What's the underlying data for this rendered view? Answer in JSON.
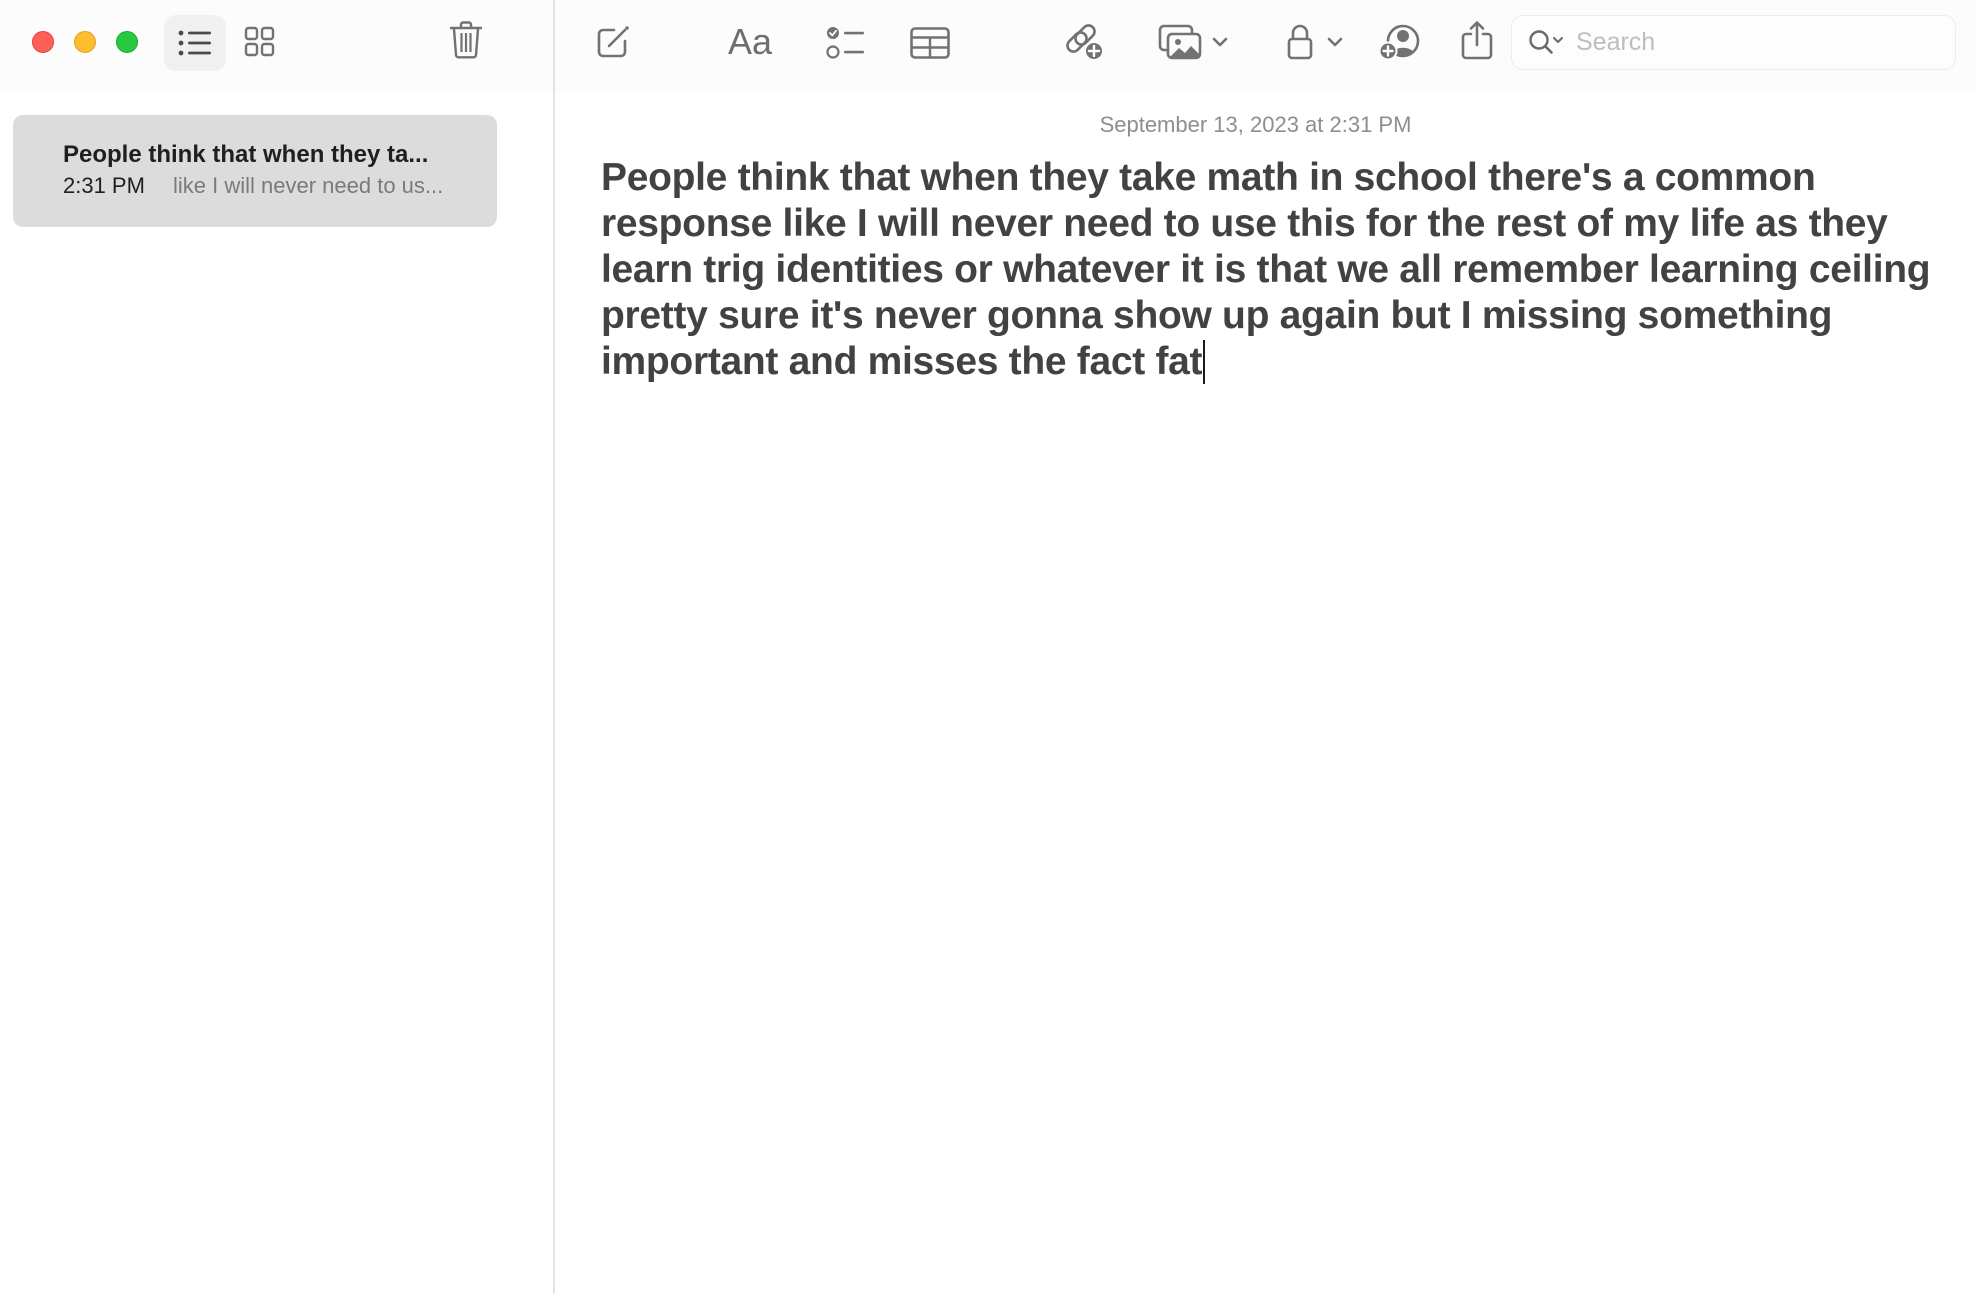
{
  "window": {
    "controls": [
      "close",
      "minimize",
      "zoom"
    ]
  },
  "sidebar_toolbar": {
    "list_view_icon": "list-bullet-icon",
    "grid_view_icon": "grid-icon",
    "delete_icon": "trash-icon"
  },
  "notes_list": [
    {
      "title": "People think that when they ta...",
      "time": "2:31 PM",
      "preview": "like I will never need to us...",
      "selected": true
    }
  ],
  "toolbar": {
    "icons": [
      "compose-icon",
      "format-text-icon",
      "checklist-icon",
      "table-icon",
      "add-link-icon",
      "media-icon",
      "lock-icon",
      "collaborate-icon",
      "share-icon"
    ],
    "format_label": "Aa",
    "search": {
      "placeholder": "Search",
      "value": ""
    }
  },
  "note": {
    "timestamp": "September 13, 2023 at 2:31 PM",
    "body": "People think that when they take math in school there's a common response like I will never need to use this for the rest of my life as they learn trig identities or whatever it is that we all remember learning ceiling pretty sure it's never gonna show up again but I missing something important and misses the fact fat"
  }
}
